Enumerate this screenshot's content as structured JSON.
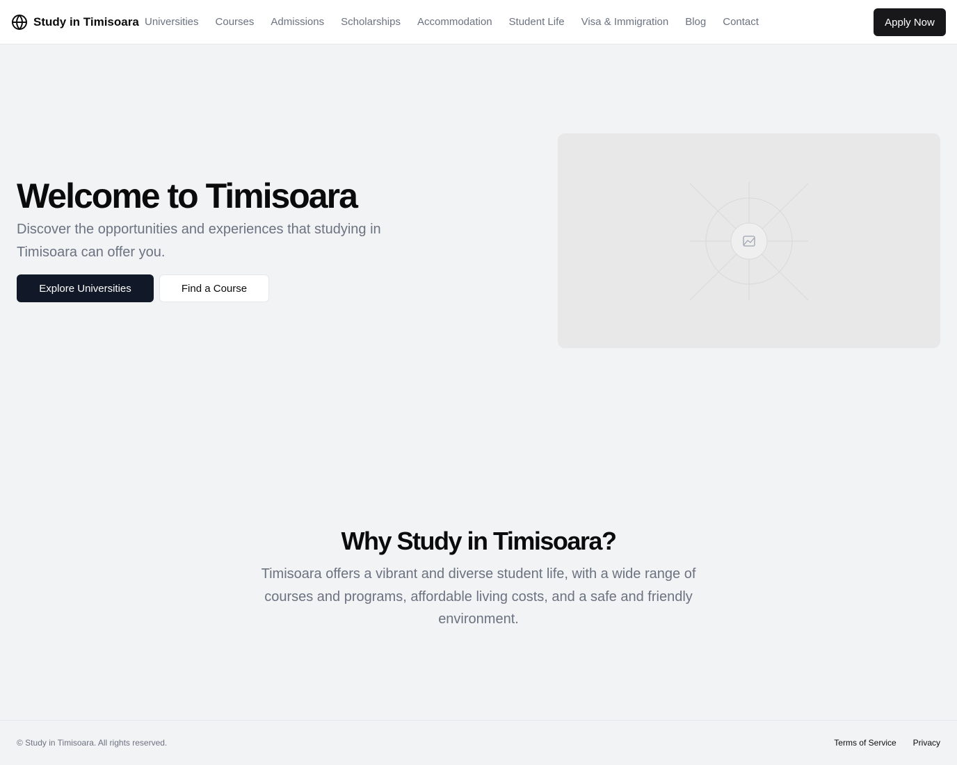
{
  "header": {
    "brand": "Study in Timisoara",
    "brand_icon": "globe-icon",
    "nav": [
      {
        "label": "Universities"
      },
      {
        "label": "Courses"
      },
      {
        "label": "Admissions"
      },
      {
        "label": "Scholarships"
      },
      {
        "label": "Accommodation"
      },
      {
        "label": "Student Life"
      },
      {
        "label": "Visa & Immigration"
      },
      {
        "label": "Blog"
      },
      {
        "label": "Contact"
      }
    ],
    "cta": "Apply Now"
  },
  "hero": {
    "title": "Welcome to Timisoara",
    "subtitle": "Discover the opportunities and experiences that studying in Timisoara can offer you.",
    "primary_button": "Explore Universities",
    "secondary_button": "Find a Course",
    "image_icon": "image-placeholder-icon"
  },
  "why": {
    "title": "Why Study in Timisoara?",
    "text": "Timisoara offers a vibrant and diverse student life, with a wide range of courses and programs, affordable living costs, and a safe and friendly environment."
  },
  "footer": {
    "copyright": "© Study in Timisoara. All rights reserved.",
    "links": [
      {
        "label": "Terms of Service"
      },
      {
        "label": "Privacy"
      }
    ]
  },
  "colors": {
    "page_background": "#f2f3f5",
    "primary_button": "#111827",
    "header_cta": "#18181b",
    "muted_text": "#6b7280"
  }
}
